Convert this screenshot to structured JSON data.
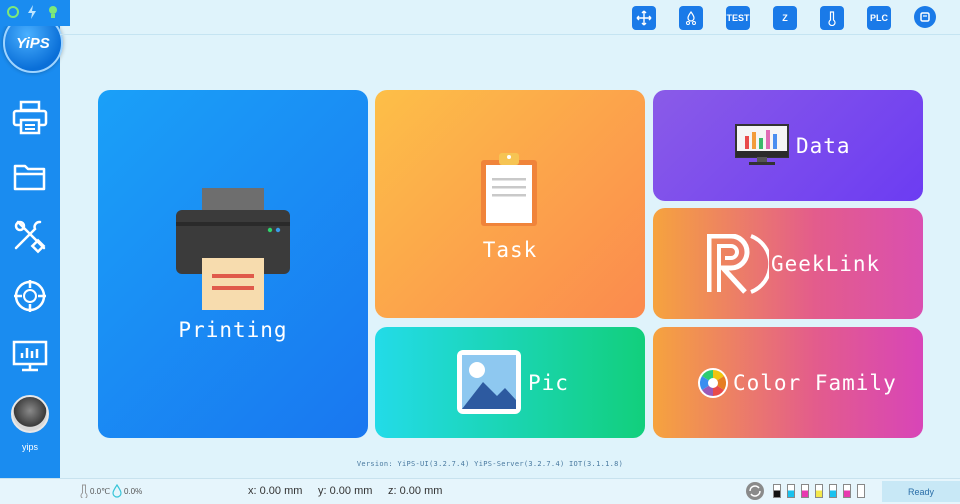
{
  "sidebar": {
    "logo_text": "YiPS",
    "nav": [
      "printer-icon",
      "folder-icon",
      "tools-icon",
      "target-icon",
      "monitor-chart-icon"
    ],
    "user_name": "yips"
  },
  "toolbar": {
    "buttons": [
      {
        "icon": "move-icon",
        "label": ""
      },
      {
        "icon": "ink-drops-icon",
        "label": ""
      },
      {
        "icon": "",
        "label": "TEST"
      },
      {
        "icon": "",
        "label": "Z"
      },
      {
        "icon": "thermometer-icon",
        "label": ""
      },
      {
        "icon": "",
        "label": "PLC"
      },
      {
        "icon": "stop-icon",
        "label": ""
      }
    ]
  },
  "tiles": {
    "printing": "Printing",
    "task": "Task",
    "data": "Data",
    "geeklink": "GeekLink",
    "pic": "Pic",
    "color_family": "Color Family"
  },
  "version": "Version: YiPS-UI(3.2.7.4) YiPS-Server(3.2.7.4) IOT(3.1.1.8)",
  "status": {
    "temperature": "0.0℃",
    "humidity": "0.0%",
    "x": "x:  0.00 mm",
    "y": "y:  0.00 mm",
    "z": "z:  0.00 mm",
    "ready": "Ready",
    "ink_colors": [
      "#111111",
      "#19c2ef",
      "#e838b0",
      "#f4e84a",
      "#19c2ef",
      "#e838b0",
      "#ffffff"
    ]
  },
  "colors": {
    "sidebar": "#1a8cf0",
    "background": "#dff3fb",
    "accent": "#1a7ae8"
  }
}
